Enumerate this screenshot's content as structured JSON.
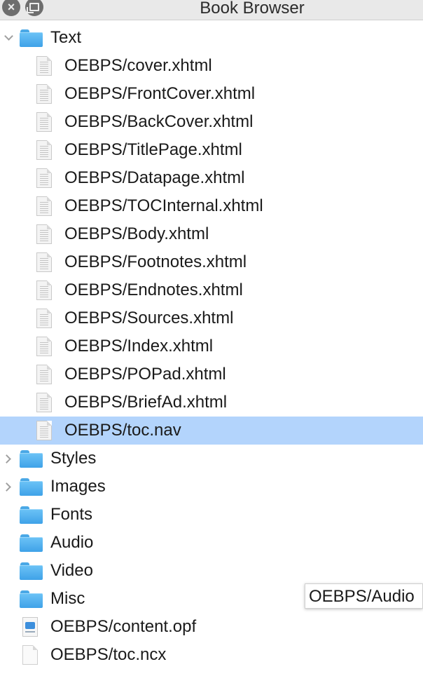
{
  "window": {
    "title": "Book Browser",
    "close_glyph": "×",
    "close_icon": "close-icon",
    "float_icon": "float-window-icon"
  },
  "tree": {
    "text_folder": {
      "label": "Text",
      "expanded": true,
      "files": [
        {
          "label": "OEBPS/cover.xhtml",
          "selected": false
        },
        {
          "label": "OEBPS/FrontCover.xhtml",
          "selected": false
        },
        {
          "label": "OEBPS/BackCover.xhtml",
          "selected": false
        },
        {
          "label": "OEBPS/TitlePage.xhtml",
          "selected": false
        },
        {
          "label": "OEBPS/Datapage.xhtml",
          "selected": false
        },
        {
          "label": "OEBPS/TOCInternal.xhtml",
          "selected": false
        },
        {
          "label": "OEBPS/Body.xhtml",
          "selected": false
        },
        {
          "label": "OEBPS/Footnotes.xhtml",
          "selected": false
        },
        {
          "label": "OEBPS/Endnotes.xhtml",
          "selected": false
        },
        {
          "label": "OEBPS/Sources.xhtml",
          "selected": false
        },
        {
          "label": "OEBPS/Index.xhtml",
          "selected": false
        },
        {
          "label": "OEBPS/POPad.xhtml",
          "selected": false
        },
        {
          "label": "OEBPS/BriefAd.xhtml",
          "selected": false
        },
        {
          "label": "OEBPS/toc.nav",
          "selected": true
        }
      ]
    },
    "folders": [
      {
        "label": "Styles",
        "collapsible": true
      },
      {
        "label": "Images",
        "collapsible": true
      },
      {
        "label": "Fonts",
        "collapsible": false
      },
      {
        "label": "Audio",
        "collapsible": false
      },
      {
        "label": "Video",
        "collapsible": false
      },
      {
        "label": "Misc",
        "collapsible": false
      }
    ],
    "root_files": [
      {
        "label": "OEBPS/content.opf",
        "icon": "opf-file-icon"
      },
      {
        "label": "OEBPS/toc.ncx",
        "icon": "blank-file-icon"
      }
    ]
  },
  "tooltip": {
    "text": "OEBPS/Audio"
  },
  "colors": {
    "selection": "#b3d4fc",
    "folder": "#4aa8e6"
  }
}
